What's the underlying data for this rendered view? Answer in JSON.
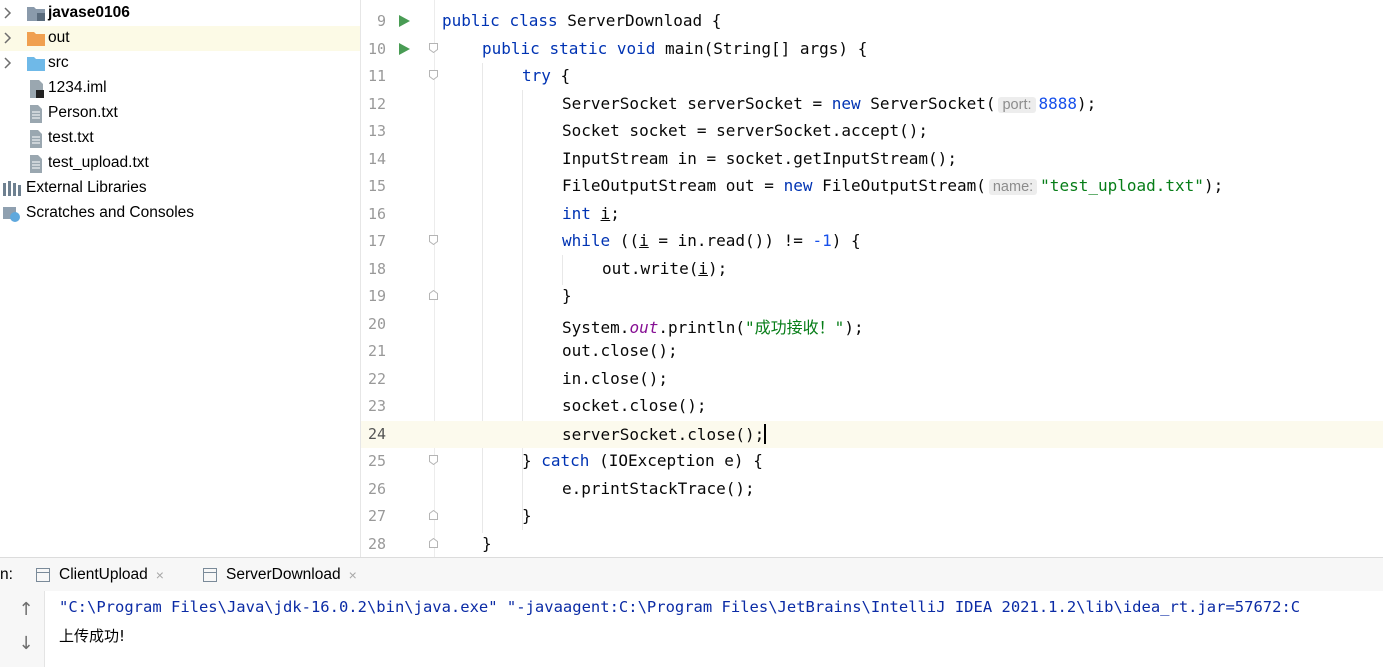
{
  "project_tree": [
    {
      "label": "javase0106",
      "icon": "module-folder-icon",
      "chevron": true,
      "bold": true
    },
    {
      "label": "out",
      "icon": "orange-folder-icon",
      "chevron": true,
      "selected": true
    },
    {
      "label": "src",
      "icon": "source-folder-icon",
      "chevron": true
    },
    {
      "label": "1234.iml",
      "icon": "iml-file-icon",
      "chevron": false
    },
    {
      "label": "Person.txt",
      "icon": "text-file-icon",
      "chevron": false
    },
    {
      "label": "test.txt",
      "icon": "text-file-icon",
      "chevron": false
    },
    {
      "label": "test_upload.txt",
      "icon": "text-file-icon",
      "chevron": false
    },
    {
      "label": "External Libraries",
      "icon": "libraries-icon",
      "chevron": false
    },
    {
      "label": "Scratches and Consoles",
      "icon": "scratches-icon",
      "chevron": false
    }
  ],
  "editor": {
    "line_numbers": [
      "9",
      "10",
      "11",
      "12",
      "13",
      "14",
      "15",
      "16",
      "17",
      "18",
      "19",
      "20",
      "21",
      "22",
      "23",
      "24",
      "25",
      "26",
      "27",
      "28"
    ],
    "current_line": "24",
    "tokens": {
      "l9": [
        "public",
        "class",
        " ServerDownload {"
      ],
      "l10": [
        "public",
        "static",
        "void",
        " main(String[] args) {"
      ],
      "l11": [
        "try",
        " {"
      ],
      "l12": [
        "ServerSocket serverSocket = ",
        "new",
        " ServerSocket(",
        "port:",
        "8888",
        ");"
      ],
      "l13": [
        "Socket socket = serverSocket.accept();"
      ],
      "l14": [
        "InputStream in = socket.getInputStream();"
      ],
      "l15": [
        "FileOutputStream out = ",
        "new",
        " FileOutputStream(",
        "name:",
        "\"test_upload.txt\"",
        ");"
      ],
      "l16": [
        "int",
        " ",
        "i",
        ";"
      ],
      "l17": [
        "while",
        " ((",
        "i",
        " = in.read()) != ",
        "-1",
        ") {"
      ],
      "l18": [
        "out.write(",
        "i",
        ");"
      ],
      "l19": [
        "}"
      ],
      "l20": [
        "System.",
        "out",
        ".println(",
        "\"成功接收！\"",
        ");"
      ],
      "l21": [
        "out.close();"
      ],
      "l22": [
        "in.close();"
      ],
      "l23": [
        "socket.close();"
      ],
      "l24": [
        "serverSocket.close();"
      ],
      "l25": [
        "} ",
        "catch",
        " (IOException e) {"
      ],
      "l26": [
        "e.printStackTrace();"
      ],
      "l27": [
        "}"
      ],
      "l28": [
        "}"
      ]
    }
  },
  "run_panel": {
    "prefix": "n:",
    "tabs": [
      {
        "label": "ClientUpload",
        "close": "×"
      },
      {
        "label": "ServerDownload",
        "close": "×"
      }
    ]
  },
  "console": {
    "command": "\"C:\\Program Files\\Java\\jdk-16.0.2\\bin\\java.exe\" \"-javaagent:C:\\Program Files\\JetBrains\\IntelliJ IDEA 2021.1.2\\lib\\idea_rt.jar=57672:C",
    "output": "上传成功!",
    "up_arrow": "↑",
    "down_arrow": "↓"
  },
  "colors": {
    "keyword": "#0033b3",
    "number": "#1750eb",
    "string": "#067d17",
    "static_field": "#871094",
    "run_icon": "#499c54",
    "current_line": "#fcfaed",
    "selected_row": "#fcfae6"
  }
}
